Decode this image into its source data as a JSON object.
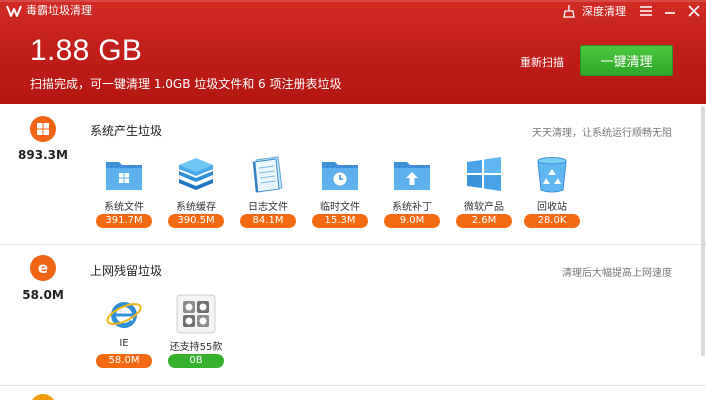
{
  "app": {
    "title": "毒霸垃圾清理",
    "deep_clean_label": "深度清理"
  },
  "summary": {
    "total_size": "1.88 GB",
    "scan_result": "扫描完成，可一键清理 1.0GB 垃圾文件和 6 项注册表垃圾",
    "rescan_label": "重新扫描",
    "clean_button_label": "一键清理"
  },
  "sections": [
    {
      "size": "893.3M",
      "title": "系统产生垃圾",
      "description": "天天清理，让系统运行顺畅无阻",
      "icon": "windows-icon",
      "items": [
        {
          "label": "系统文件",
          "size": "391.7M",
          "icon": "folder-windows-icon"
        },
        {
          "label": "系统缓存",
          "size": "390.5M",
          "icon": "cache-stack-icon"
        },
        {
          "label": "日志文件",
          "size": "84.1M",
          "icon": "log-notebook-icon"
        },
        {
          "label": "临时文件",
          "size": "15.3M",
          "icon": "folder-temp-icon"
        },
        {
          "label": "系统补丁",
          "size": "9.0M",
          "icon": "folder-patch-icon"
        },
        {
          "label": "微软产品",
          "size": "2.6M",
          "icon": "windows-logo-icon"
        },
        {
          "label": "回收站",
          "size": "28.0K",
          "icon": "recycle-bin-icon"
        }
      ]
    },
    {
      "size": "58.0M",
      "title": "上网残留垃圾",
      "description": "清理后大幅提高上网速度",
      "icon": "browser-e-icon",
      "items": [
        {
          "label": "IE",
          "size": "58.0M",
          "icon": "ie-icon"
        },
        {
          "label": "还支持55款",
          "size": "0B",
          "icon": "browser-grid-icon"
        }
      ]
    }
  ],
  "colors": {
    "header": "#c01c18",
    "accent_orange": "#f36a12",
    "accent_green": "#36b12e"
  }
}
